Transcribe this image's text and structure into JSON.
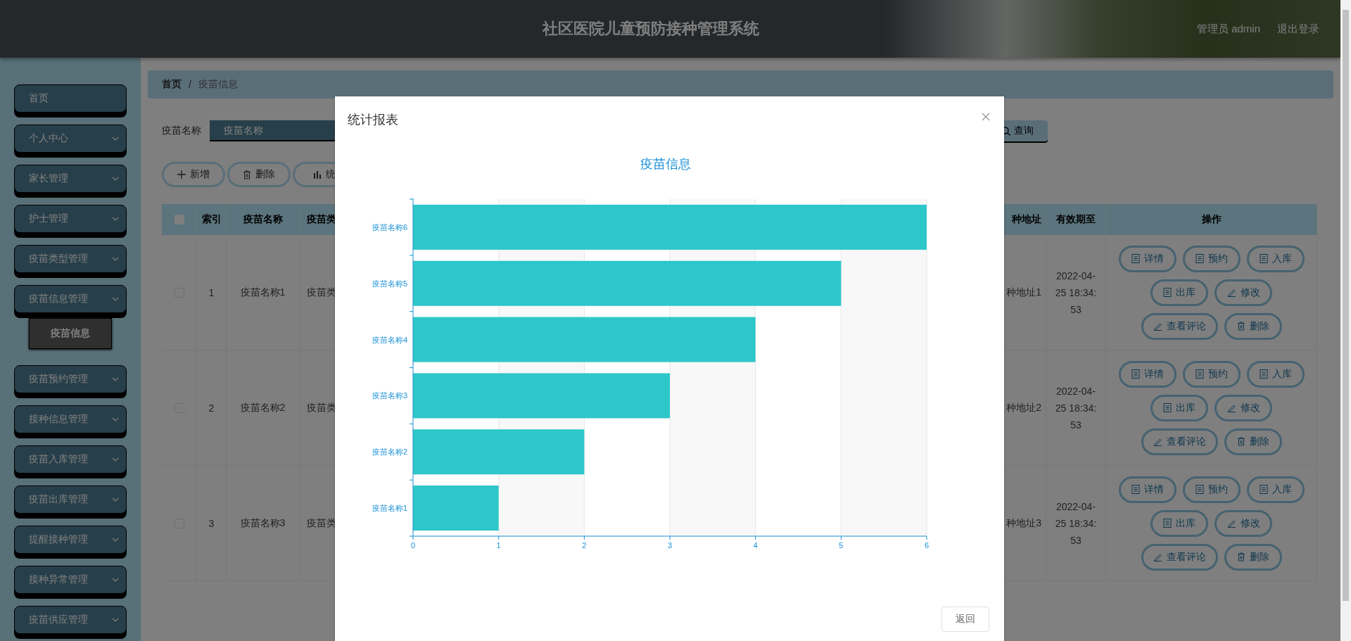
{
  "header": {
    "title": "社区医院儿童预防接种管理系统",
    "user": "管理员 admin",
    "logout": "退出登录"
  },
  "sidebar": {
    "items": [
      {
        "label": "首页",
        "kind": "link"
      },
      {
        "label": "个人中心",
        "kind": "menu"
      },
      {
        "label": "家长管理",
        "kind": "menu"
      },
      {
        "label": "护士管理",
        "kind": "menu"
      },
      {
        "label": "疫苗类型管理",
        "kind": "menu"
      },
      {
        "label": "疫苗信息管理",
        "kind": "menu",
        "children": [
          {
            "label": "疫苗信息",
            "selected": true
          }
        ]
      },
      {
        "label": "疫苗预约管理",
        "kind": "menu"
      },
      {
        "label": "接种信息管理",
        "kind": "menu"
      },
      {
        "label": "疫苗入库管理",
        "kind": "menu"
      },
      {
        "label": "疫苗出库管理",
        "kind": "menu"
      },
      {
        "label": "提醒接种管理",
        "kind": "menu"
      },
      {
        "label": "接种异常管理",
        "kind": "menu"
      },
      {
        "label": "疫苗供应管理",
        "kind": "menu"
      }
    ]
  },
  "breadcrumb": {
    "items": [
      "首页",
      "疫苗信息"
    ],
    "separator": "/"
  },
  "search": {
    "label": "疫苗名称",
    "placeholder": "疫苗名称",
    "button": "查询"
  },
  "toolbar": [
    {
      "label": "新增",
      "kind": "add"
    },
    {
      "label": "删除",
      "kind": "delete"
    },
    {
      "label": "统",
      "kind": "stats"
    }
  ],
  "table": {
    "header_checked": false,
    "columns": [
      "索引",
      "疫苗名称",
      "疫苗类",
      "种地址",
      "有效期至",
      "操作"
    ],
    "rows": [
      {
        "checked": false,
        "index": "1",
        "name": "疫苗名称1",
        "type": "疫苗类",
        "address": "种地址1",
        "expiry": "2022-04-25 18:34:53",
        "actions": [
          {
            "label": "详情",
            "kind": "details"
          },
          {
            "label": "预约",
            "kind": "reserve"
          },
          {
            "label": "入库",
            "kind": "stock-in"
          },
          {
            "label": "出库",
            "kind": "stock-out"
          },
          {
            "label": "修改",
            "kind": "edit"
          },
          {
            "label": "查看评论",
            "kind": "comments"
          },
          {
            "label": "删除",
            "kind": "delete"
          }
        ]
      },
      {
        "checked": false,
        "index": "2",
        "name": "疫苗名称2",
        "type": "疫苗类",
        "address": "种地址2",
        "expiry": "2022-04-25 18:34:53",
        "actions": [
          {
            "label": "详情",
            "kind": "details"
          },
          {
            "label": "预约",
            "kind": "reserve"
          },
          {
            "label": "入库",
            "kind": "stock-in"
          },
          {
            "label": "出库",
            "kind": "stock-out"
          },
          {
            "label": "修改",
            "kind": "edit"
          },
          {
            "label": "查看评论",
            "kind": "comments"
          },
          {
            "label": "删除",
            "kind": "delete"
          }
        ]
      },
      {
        "checked": false,
        "index": "3",
        "name": "疫苗名称3",
        "type": "疫苗类",
        "address": "种地址3",
        "expiry": "2022-04-25 18:34:53",
        "actions": [
          {
            "label": "详情",
            "kind": "details"
          },
          {
            "label": "预约",
            "kind": "reserve"
          },
          {
            "label": "入库",
            "kind": "stock-in"
          },
          {
            "label": "出库",
            "kind": "stock-out"
          },
          {
            "label": "修改",
            "kind": "edit"
          },
          {
            "label": "查看评论",
            "kind": "comments"
          },
          {
            "label": "删除",
            "kind": "delete"
          }
        ]
      }
    ]
  },
  "modal": {
    "title": "统计报表",
    "back_button": "返回",
    "chart_data": {
      "type": "bar",
      "orientation": "horizontal",
      "title": "疫苗信息",
      "categories": [
        "疫苗名称6",
        "疫苗名称5",
        "疫苗名称4",
        "疫苗名称3",
        "疫苗名称2",
        "疫苗名称1"
      ],
      "series": [
        {
          "color": "#2ec7c9",
          "values": [
            6,
            5,
            4,
            3,
            2,
            1
          ]
        }
      ],
      "grid": true,
      "xlim": [
        0,
        6
      ],
      "xticks": [
        0,
        1,
        2,
        3,
        4,
        5,
        6
      ]
    }
  }
}
